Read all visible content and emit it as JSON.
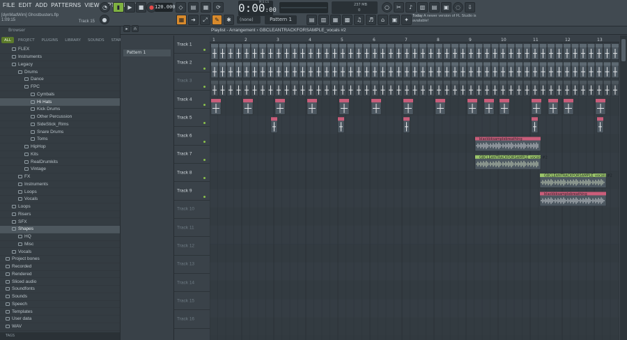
{
  "menu": [
    "FILE",
    "EDIT",
    "ADD",
    "PATTERNS",
    "VIEW",
    "OPTIONS",
    "TOOLS",
    "HELP"
  ],
  "project": {
    "author": "[dynMadWim]",
    "file": "Ghostbusters.flp",
    "time": "1:09:15",
    "track": "Track 15"
  },
  "transport": {
    "tempo": "120.000",
    "time_main": "0:00",
    "time_sub": ":00",
    "time_label": "M:S:CS"
  },
  "cpu": {
    "mem": "237 MB",
    "count": "0"
  },
  "toolbar": {
    "snap": "(none)",
    "pattern": "Pattern 1"
  },
  "news": {
    "title": "Today",
    "text": "A newer version of FL Studio is available!"
  },
  "browser": {
    "title": "Browser",
    "tabs": [
      "ALL",
      "PROJECT",
      "PLUGINS",
      "LIBRARY",
      "SOUNDS",
      "STARRED"
    ],
    "items": [
      {
        "label": "FLEX",
        "indent": 1
      },
      {
        "label": "Instruments",
        "indent": 1
      },
      {
        "label": "Legacy",
        "indent": 1
      },
      {
        "label": "Drums",
        "indent": 2
      },
      {
        "label": "Dance",
        "indent": 3
      },
      {
        "label": "FPC",
        "indent": 3
      },
      {
        "label": "Cymbals",
        "indent": 4
      },
      {
        "label": "Hi Hats",
        "indent": 4
      },
      {
        "label": "Kick Drums",
        "indent": 4
      },
      {
        "label": "Other Percussion",
        "indent": 4
      },
      {
        "label": "SideStick_Rims",
        "indent": 4
      },
      {
        "label": "Snare Drums",
        "indent": 4
      },
      {
        "label": "Toms",
        "indent": 4
      },
      {
        "label": "HipHop",
        "indent": 3
      },
      {
        "label": "Kits",
        "indent": 3
      },
      {
        "label": "RealDrumkits",
        "indent": 3
      },
      {
        "label": "Vintage",
        "indent": 3
      },
      {
        "label": "FX",
        "indent": 2
      },
      {
        "label": "Instruments",
        "indent": 2
      },
      {
        "label": "Loops",
        "indent": 2
      },
      {
        "label": "Vocals",
        "indent": 2
      },
      {
        "label": "Loops",
        "indent": 1
      },
      {
        "label": "Risers",
        "indent": 1
      },
      {
        "label": "SFX",
        "indent": 1
      },
      {
        "label": "Shapes",
        "indent": 1
      },
      {
        "label": "HQ",
        "indent": 2
      },
      {
        "label": "Misc",
        "indent": 2
      },
      {
        "label": "Vocals",
        "indent": 1
      },
      {
        "label": "Project bones",
        "indent": 0
      },
      {
        "label": "Recorded",
        "indent": 0
      },
      {
        "label": "Rendered",
        "indent": 0
      },
      {
        "label": "Sliced audio",
        "indent": 0
      },
      {
        "label": "Soundfonts",
        "indent": 0
      },
      {
        "label": "Sounds",
        "indent": 0
      },
      {
        "label": "Speech",
        "indent": 0
      },
      {
        "label": "Templates",
        "indent": 0
      },
      {
        "label": "User data",
        "indent": 0
      },
      {
        "label": "WAV",
        "indent": 0
      }
    ],
    "tags": "TAGS"
  },
  "playlist": {
    "title": "Playlist - Arrangement",
    "breadcrumb": "GBCLEANTRACKFORSAMPLE_vocals #2",
    "pattern": "Pattern 1",
    "tracks": [
      "Track 1",
      "Track 2",
      "Track 3",
      "Track 4",
      "Track 5",
      "Track 6",
      "Track 7",
      "Track 8",
      "Track 9",
      "Track 10",
      "Track 11",
      "Track 12",
      "Track 13",
      "Track 14",
      "Track 15",
      "Track 16"
    ],
    "bars": [
      "1",
      "2",
      "3",
      "4",
      "5",
      "6",
      "7",
      "8",
      "9",
      "10",
      "11",
      "12",
      "13"
    ],
    "clips": [
      {
        "label": "blackbksamplebreathing"
      },
      {
        "label": "GBCLEANTRACKFORSAMPLE_vocals #2"
      },
      {
        "label": "GBCLEANTRACKFORSAMPLE_vocals #2"
      },
      {
        "label": "blackbksamplebreathing"
      }
    ]
  }
}
